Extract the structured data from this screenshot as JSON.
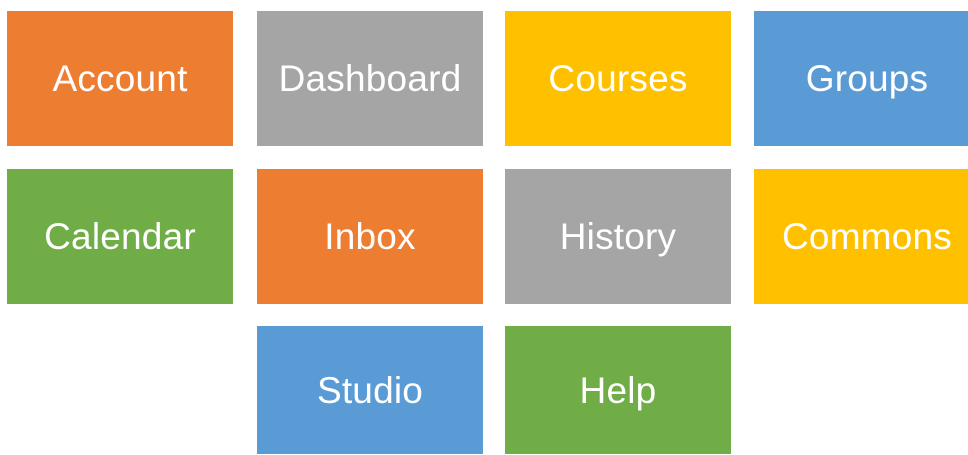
{
  "colors": {
    "orange": "#ED7D31",
    "gray": "#A5A5A5",
    "yellow": "#FFC000",
    "blue": "#5B9BD5",
    "green": "#70AD47",
    "label": "#FFFFFF"
  },
  "tiles": [
    {
      "label": "Account",
      "color": "orange"
    },
    {
      "label": "Dashboard",
      "color": "gray"
    },
    {
      "label": "Courses",
      "color": "yellow"
    },
    {
      "label": "Groups",
      "color": "blue"
    },
    {
      "label": "Calendar",
      "color": "green"
    },
    {
      "label": "Inbox",
      "color": "orange"
    },
    {
      "label": "History",
      "color": "gray"
    },
    {
      "label": "Commons",
      "color": "yellow"
    },
    {
      "label": "Studio",
      "color": "blue"
    },
    {
      "label": "Help",
      "color": "green"
    }
  ]
}
